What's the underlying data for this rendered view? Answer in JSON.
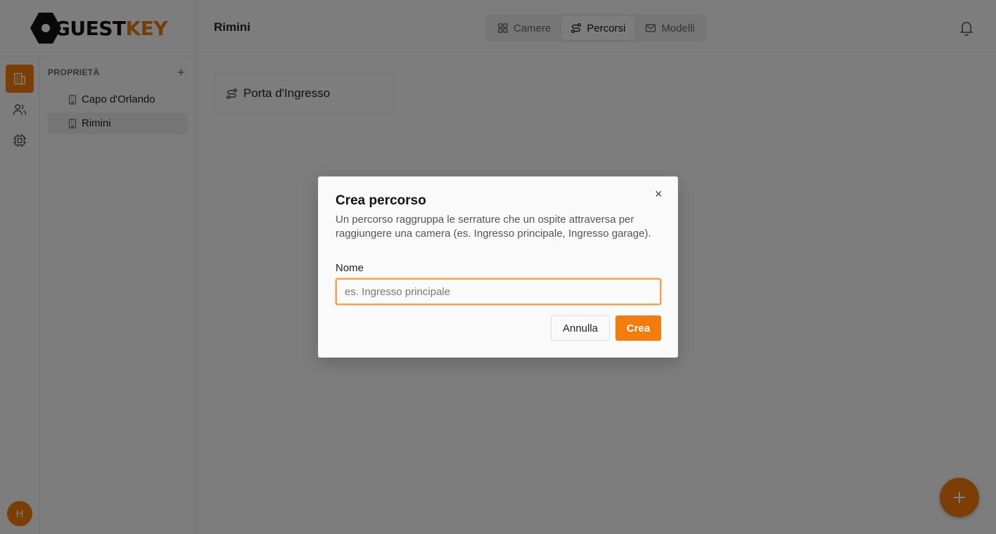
{
  "brand": {
    "name_part1": "GUEST",
    "name_part2": "KEY",
    "accent_color": "#f47c0c"
  },
  "header": {
    "title": "Rimini",
    "tabs": [
      {
        "label": "Camere",
        "icon": "grid-icon",
        "active": false
      },
      {
        "label": "Percorsi",
        "icon": "route-icon",
        "active": true
      },
      {
        "label": "Modelli",
        "icon": "mail-icon",
        "active": false
      }
    ],
    "notifications_icon": "bell-icon"
  },
  "rail": {
    "items": [
      {
        "icon": "building-icon",
        "active": true
      },
      {
        "icon": "users-icon",
        "active": false
      },
      {
        "icon": "chip-icon",
        "active": false
      }
    ],
    "avatar_initial": "H"
  },
  "sidebar": {
    "heading": "PROPRIETÀ",
    "add_symbol": "+",
    "items": [
      {
        "label": "Capo d'Orlando",
        "active": false
      },
      {
        "label": "Rimini",
        "active": true
      }
    ]
  },
  "main": {
    "routes": [
      {
        "label": "Porta d'Ingresso"
      }
    ]
  },
  "dialog": {
    "title": "Crea percorso",
    "close_symbol": "×",
    "description": "Un percorso raggruppa le serrature che un ospite attraversa per raggiungere una camera (es. Ingresso principale, Ingresso garage).",
    "name_label": "Nome",
    "name_value": "",
    "name_placeholder": "es. Ingresso principale",
    "cancel_label": "Annulla",
    "create_label": "Crea"
  }
}
